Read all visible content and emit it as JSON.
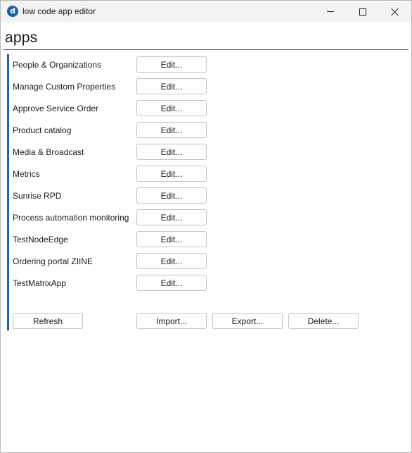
{
  "window": {
    "title": "low code app editor",
    "icon_letter": "d",
    "icon": "app-logo-icon",
    "controls": [
      "minimize-icon",
      "maximize-icon",
      "close-icon"
    ]
  },
  "page": {
    "title": "apps"
  },
  "apps": [
    {
      "name": "People & Organizations",
      "edit_label": "Edit..."
    },
    {
      "name": "Manage Custom Properties",
      "edit_label": "Edit..."
    },
    {
      "name": "Approve Service Order",
      "edit_label": "Edit..."
    },
    {
      "name": "Product catalog",
      "edit_label": "Edit..."
    },
    {
      "name": "Media & Broadcast",
      "edit_label": "Edit..."
    },
    {
      "name": "Metrics",
      "edit_label": "Edit..."
    },
    {
      "name": "Sunrise RPD",
      "edit_label": "Edit..."
    },
    {
      "name": "Process automation monitoring",
      "edit_label": "Edit..."
    },
    {
      "name": "TestNodeEdge",
      "edit_label": "Edit..."
    },
    {
      "name": "Ordering portal ZIINE",
      "edit_label": "Edit..."
    },
    {
      "name": "TestMatrixApp",
      "edit_label": "Edit..."
    }
  ],
  "actions": {
    "refresh_label": "Refresh",
    "import_label": "Import...",
    "export_label": "Export...",
    "delete_label": "Delete..."
  },
  "colors": {
    "accent": "#1c62a6",
    "header_rule": "#1f5f94",
    "titlebar": "#f3f3f3"
  }
}
